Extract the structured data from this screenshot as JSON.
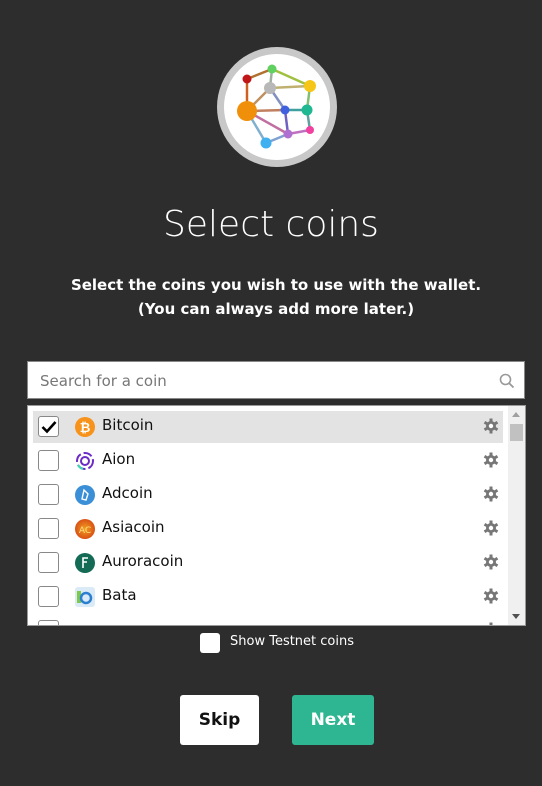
{
  "header": {
    "logo": "wallet-network-logo",
    "title": "Select coins",
    "subtitle_line1": "Select the coins you wish to use with the wallet.",
    "subtitle_line2": "(You can always add more later.)"
  },
  "search": {
    "placeholder": "Search for a coin",
    "value": "",
    "icon": "search-icon"
  },
  "coins": [
    {
      "name": "Bitcoin",
      "checked": true,
      "icon": "bitcoin-icon",
      "color": "#f7931a"
    },
    {
      "name": "Aion",
      "checked": false,
      "icon": "aion-icon",
      "color": "#6c2bc6"
    },
    {
      "name": "Adcoin",
      "checked": false,
      "icon": "adcoin-icon",
      "color": "#3b8fd6"
    },
    {
      "name": "Asiacoin",
      "checked": false,
      "icon": "asiacoin-icon",
      "color": "#e05a1c"
    },
    {
      "name": "Auroracoin",
      "checked": false,
      "icon": "auroracoin-icon",
      "color": "#146b55"
    },
    {
      "name": "Bata",
      "checked": false,
      "icon": "bata-icon",
      "color": "#3b9ad9"
    }
  ],
  "testnet": {
    "label": "Show Testnet coins",
    "checked": false
  },
  "buttons": {
    "skip": "Skip",
    "next": "Next"
  },
  "colors": {
    "background": "#2d2d2d",
    "accent": "#2eb592",
    "selected_row": "#e3e3e3"
  }
}
